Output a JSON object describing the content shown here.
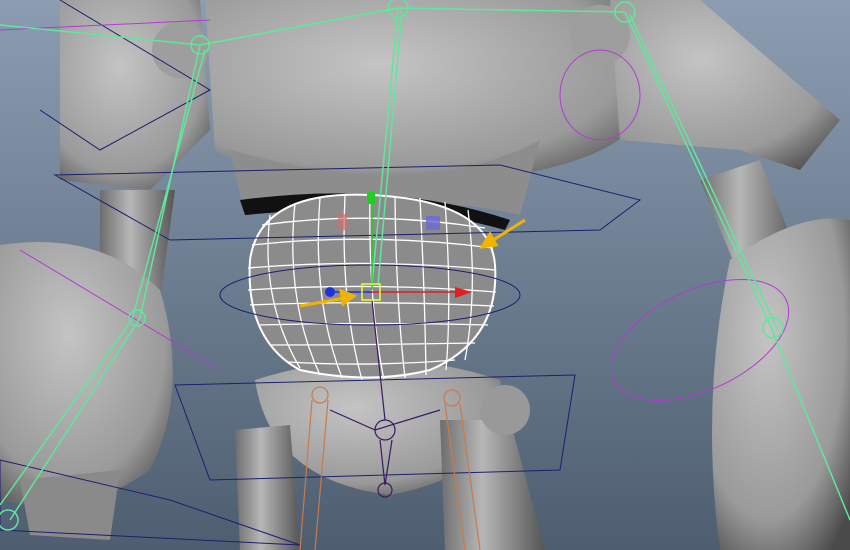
{
  "viewport": {
    "background_top": "#8c9db2",
    "background_bottom": "#4e5e70",
    "mesh_color": "#a9a9a9",
    "joint_color": "#5fe89a",
    "wireframe_color": "#ffffff",
    "curve_color": "#1c1f6e",
    "manip_x_color": "#e02020",
    "manip_y_color": "#20d020",
    "manip_z_color": "#2030e0",
    "annotation_arrow_color": "#f0b400"
  }
}
